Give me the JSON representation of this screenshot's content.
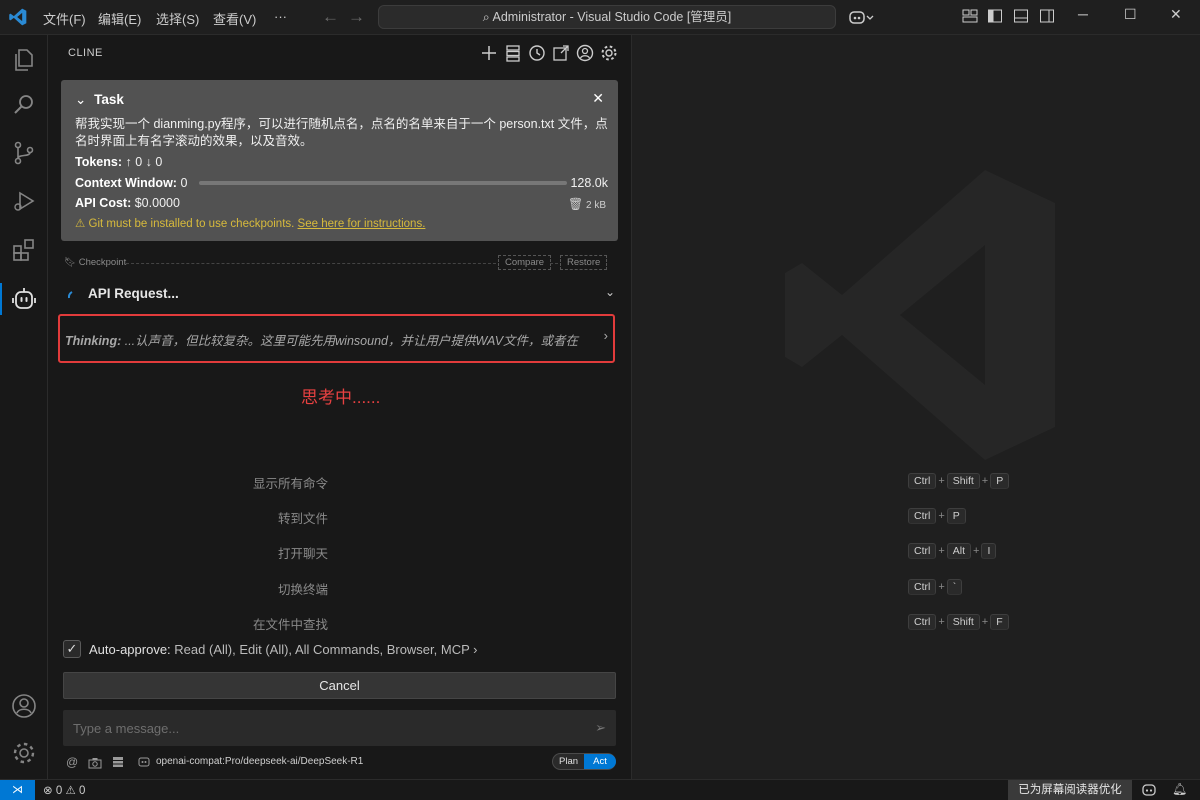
{
  "titlebar": {
    "menus": [
      "文件(F)",
      "编辑(E)",
      "选择(S)",
      "查看(V)",
      "···"
    ],
    "command_center": "Administrator - Visual Studio Code [管理员]"
  },
  "sidebar": {
    "title": "CLINE"
  },
  "task": {
    "header": "Task",
    "description": "帮我实现一个 dianming.py程序，可以进行随机点名，点名的名单来自于一个 person.txt 文件，点名时界面上有名字滚动的效果，以及音效。",
    "tokens_label": "Tokens:",
    "tokens_value": "↑ 0 ↓ 0",
    "context_label": "Context Window:",
    "context_value": "0",
    "context_max": "128.0k",
    "cost_label": "API Cost:",
    "cost_value": "$0.0000",
    "size": "2 kB",
    "warning_text": "Git must be installed to use checkpoints.",
    "warning_link": "See here for instructions."
  },
  "checkpoint": {
    "label": "Checkpoint",
    "compare": "Compare",
    "restore": "Restore"
  },
  "api_request": {
    "label": "API Request..."
  },
  "thinking": {
    "label": "Thinking:",
    "text": "...认声音，但比较复杂。这里可能先用winsound，并让用户提供WAV文件，或者在"
  },
  "annotation": "思考中......",
  "auto_approve": {
    "label": "Auto-approve:",
    "value": "Read (All), Edit (All), All Commands, Browser, MCP"
  },
  "cancel_label": "Cancel",
  "message": {
    "placeholder": "Type a message..."
  },
  "model": "openai-compat:Pro/deepseek-ai/DeepSeek-R1",
  "mode": {
    "plan": "Plan",
    "act": "Act"
  },
  "shortcuts": [
    {
      "label": "显示所有命令",
      "keys": [
        "Ctrl",
        "Shift",
        "P"
      ]
    },
    {
      "label": "转到文件",
      "keys": [
        "Ctrl",
        "P"
      ]
    },
    {
      "label": "打开聊天",
      "keys": [
        "Ctrl",
        "Alt",
        "I"
      ]
    },
    {
      "label": "切换终端",
      "keys": [
        "Ctrl",
        "`"
      ]
    },
    {
      "label": "在文件中查找",
      "keys": [
        "Ctrl",
        "Shift",
        "F"
      ]
    }
  ],
  "statusbar": {
    "errors": "0",
    "warnings": "0",
    "reader": "已为屏幕阅读器优化"
  },
  "colors": {
    "accent": "#0078d4",
    "annotation": "#e84141",
    "warning": "#d7ba3c"
  }
}
